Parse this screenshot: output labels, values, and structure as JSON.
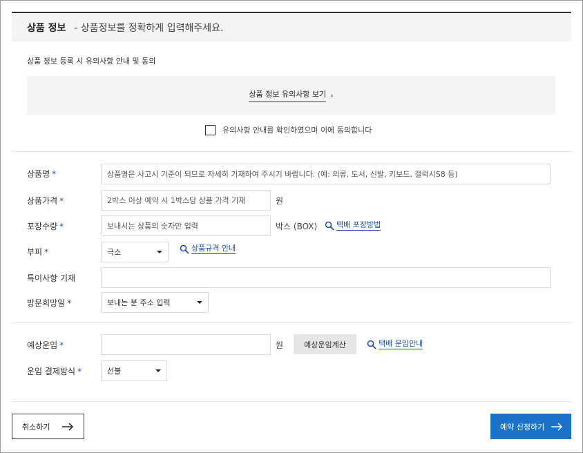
{
  "header": {
    "title": "상품 정보",
    "subtitle": "- 상품정보를 정확하게 입력해주세요."
  },
  "notice": {
    "label": "상품 정보 등록 시 유의사항 안내 및 동의",
    "view_link": "상품 정보 유의사항 보기",
    "view_arrow": "›",
    "agree_label": "유의사항 안내를 확인하였으며 이에 동의합니다",
    "agree_checked": false
  },
  "form": {
    "required_mark": "*",
    "product_name": {
      "label": "상품명",
      "placeholder": "상품명은 사고시 기준이 되므로 자세히 기재하여 주시기 바랍니다. (예: 의류, 도서, 신발, 키보드, 갤럭시S8 등)"
    },
    "product_price": {
      "label": "상품가격",
      "placeholder": "2박스 이상 예약 시 1박스당 상품 가격 기재",
      "unit": "원"
    },
    "package_qty": {
      "label": "포장수량",
      "placeholder": "보내시는 상품의 숫자만 입력",
      "unit": "박스 (BOX)",
      "guide_link": "택배 포장방법"
    },
    "volume": {
      "label": "부피",
      "selected": "극소",
      "guide_link": "상품규격 안내"
    },
    "special_note": {
      "label": "특이사항 기재",
      "value": ""
    },
    "visit_date": {
      "label": "방문희망일",
      "selected": "보내는 분 주소 입력"
    },
    "expected_fee": {
      "label": "예상운임",
      "value": "",
      "unit": "원",
      "calc_button": "예상운임계산",
      "guide_link": "택배 운임안내"
    },
    "payment_method": {
      "label": "운임 결제방식",
      "selected": "선불"
    }
  },
  "actions": {
    "cancel_label": "취소하기",
    "submit_label": "예약 신청하기"
  },
  "colors": {
    "accent": "#1a73c8",
    "required": "#1f4fa8",
    "panel_bg": "#f4f4f4"
  }
}
